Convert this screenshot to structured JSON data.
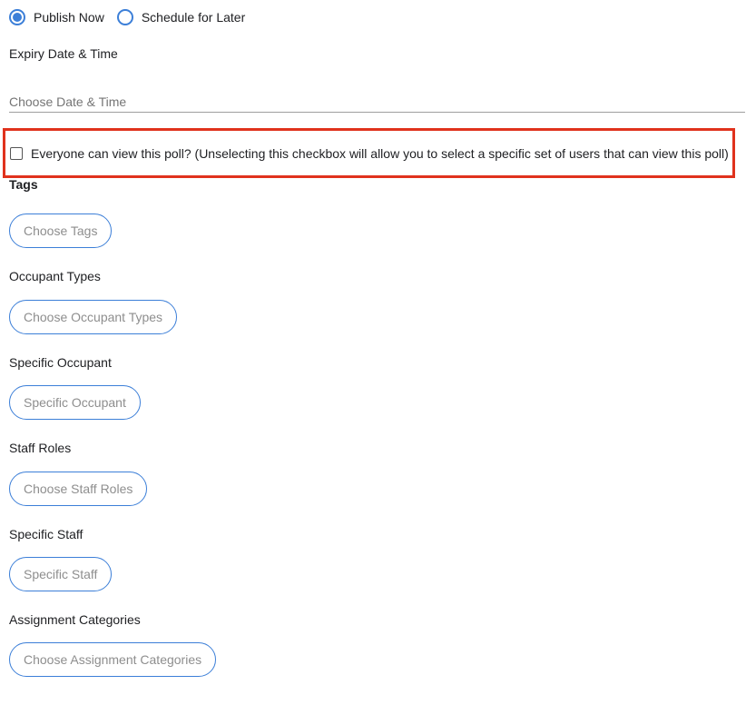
{
  "publish": {
    "options": [
      {
        "label": "Publish Now",
        "selected": true
      },
      {
        "label": "Schedule for Later",
        "selected": false
      }
    ]
  },
  "expiry": {
    "label": "Expiry Date & Time",
    "placeholder": "Choose Date & Time",
    "value": ""
  },
  "visibility": {
    "label": "Everyone can view this poll? (Unselecting this checkbox will allow you to select a specific set of users that can view this poll)",
    "checked": false
  },
  "tags": {
    "label": "Tags",
    "button": "Choose Tags"
  },
  "occupant_types": {
    "label": "Occupant Types",
    "button": "Choose Occupant Types"
  },
  "specific_occupant": {
    "label": "Specific Occupant",
    "button": "Specific Occupant"
  },
  "staff_roles": {
    "label": "Staff Roles",
    "button": "Choose Staff Roles"
  },
  "specific_staff": {
    "label": "Specific Staff",
    "button": "Specific Staff"
  },
  "assignment_categories": {
    "label": "Assignment Categories",
    "button": "Choose Assignment Categories"
  },
  "colors": {
    "accent": "#3c7fd8",
    "highlight": "#e0321d"
  }
}
